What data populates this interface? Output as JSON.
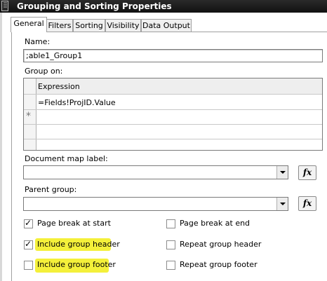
{
  "window": {
    "title": "Grouping and Sorting Properties"
  },
  "tabs": [
    "General",
    "Filters",
    "Sorting",
    "Visibility",
    "Data Output"
  ],
  "name_field": {
    "label": "Name:",
    "value": "table1_Group1",
    "shown_value": ";able1_Group1"
  },
  "group_on": {
    "label": "Group on:",
    "column_header": "Expression",
    "rows": [
      "=Fields!ProjID.Value"
    ],
    "new_row_marker": "*"
  },
  "document_map_label": {
    "label": "Document map label:",
    "value": ""
  },
  "parent_group": {
    "label": "Parent group:",
    "value": ""
  },
  "fx_label": "fx",
  "checkboxes": {
    "page_break_start": {
      "label": "Page break at start",
      "checked": true
    },
    "page_break_end": {
      "label": "Page break at end",
      "checked": false
    },
    "include_header": {
      "label": "Include group header",
      "checked": true,
      "highlighted": true
    },
    "repeat_header": {
      "label": "Repeat group header",
      "checked": false
    },
    "include_footer": {
      "label": "Include group footer",
      "checked": false,
      "highlighted": true
    },
    "repeat_footer": {
      "label": "Repeat group footer",
      "checked": false
    }
  },
  "check_mark": "✓",
  "colors": {
    "title_bar": "#1a1a1a",
    "highlight": "#f4f03a",
    "border": "#7a7a7a"
  }
}
